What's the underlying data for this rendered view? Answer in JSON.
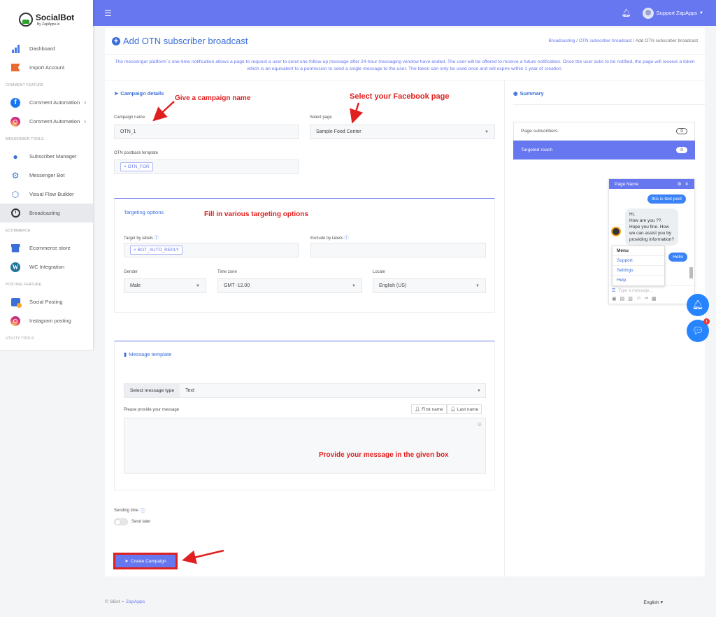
{
  "brand": {
    "name": "SocialBot",
    "sub": "By ZapApps.io"
  },
  "sidebar": {
    "items_top": [
      {
        "label": "Dashboard",
        "icon": "bar-chart-icon"
      },
      {
        "label": "Import Account",
        "icon": "flag-icon"
      }
    ],
    "header_comment": "COMMENT FEATURE",
    "comment_items": [
      {
        "label": "Comment Automation",
        "icon": "facebook-icon"
      },
      {
        "label": "Comment Automation",
        "icon": "instagram-icon"
      }
    ],
    "header_messenger": "MESSENGER TOOLS",
    "messenger_items": [
      {
        "label": "Subscriber Manager",
        "icon": "users-icon"
      },
      {
        "label": "Messenger Bot",
        "icon": "gear-icon"
      },
      {
        "label": "Visual Flow Builder",
        "icon": "flow-icon"
      },
      {
        "label": "Broadcasting",
        "icon": "clock-icon"
      }
    ],
    "header_ecommerce": "ECOMMERCE",
    "ecommerce_items": [
      {
        "label": "Ecommerce store",
        "icon": "store-icon"
      },
      {
        "label": "WC Integration",
        "icon": "wordpress-icon"
      }
    ],
    "header_posting": "POSTING FEATURE",
    "posting_items": [
      {
        "label": "Social Posting",
        "icon": "social-icon"
      },
      {
        "label": "Instagram posting",
        "icon": "instagram-icon"
      }
    ],
    "header_utility": "UTILITY TOOLS"
  },
  "topbar": {
    "user": "Support ZapApps"
  },
  "page": {
    "title": "Add OTN subscriber broadcast",
    "breadcrumb": [
      "Broadcasting",
      "OTN subscriber broadcast",
      "Add OTN subscriber broadcast"
    ],
    "description": "The messenger platform`s one-time notification allows a page to request a user to send one follow-up message after 24-hour messaging window have ended. The user will be offered to receive a future notification. Once the user asks to be notified, the page will receive a token which is an equivalent to a permission to send a single message to the user. The token can only be used once and will expire within 1 year of creation."
  },
  "campaign": {
    "section_title": "Campaign details",
    "name_label": "Campaign name",
    "name_value": "OTN_1",
    "page_label": "Select page",
    "page_value": "Sample Food Center",
    "template_label": "OTN postback template",
    "template_tag": "OTN_FOR"
  },
  "targeting": {
    "title": "Targeting options",
    "by_labels": "Target by labels",
    "by_labels_tag": "BOT_AUTO_REPLY",
    "exclude_labels": "Exclude by labels",
    "gender_label": "Gender",
    "gender_value": "Male",
    "timezone_label": "Time zone",
    "timezone_value": "GMT -12.00",
    "locale_label": "Locale",
    "locale_value": "English (US)"
  },
  "message": {
    "title": "Message template",
    "type_label": "Select message type",
    "type_value": "Text",
    "provide_label": "Please provide your message",
    "first_name": "First name",
    "last_name": "Last name"
  },
  "sending": {
    "label": "Sending time",
    "send_later": "Send later"
  },
  "create_button": "Create Campaign",
  "summary": {
    "title": "Summary",
    "rows": [
      {
        "label": "Page subscribers",
        "value": "0"
      },
      {
        "label": "Targeted reach",
        "value": "0"
      }
    ]
  },
  "preview": {
    "page_name": "Page Name",
    "out_message": "this is text post",
    "in_message": "Hi,\nHow are you ??. Hope you fine. How we can assist you by providing information?",
    "menu": [
      "Menu",
      "Support",
      "Settings",
      "Help"
    ],
    "reply": "Hello",
    "input_placeholder": "Type a message..."
  },
  "annotations": {
    "campaign_name": "Give a campaign name",
    "facebook_page": "Select your Facebook page",
    "targeting": "Fill in various targeting options",
    "message": "Provide your message in the given box"
  },
  "chat_badge": "1",
  "footer": {
    "copyright": "© SBot",
    "brand_link": "ZapApps",
    "language": "English"
  },
  "colors": {
    "accent": "#6777ef",
    "annotation": "#e02020",
    "primary_blue": "#3b6fd8"
  }
}
